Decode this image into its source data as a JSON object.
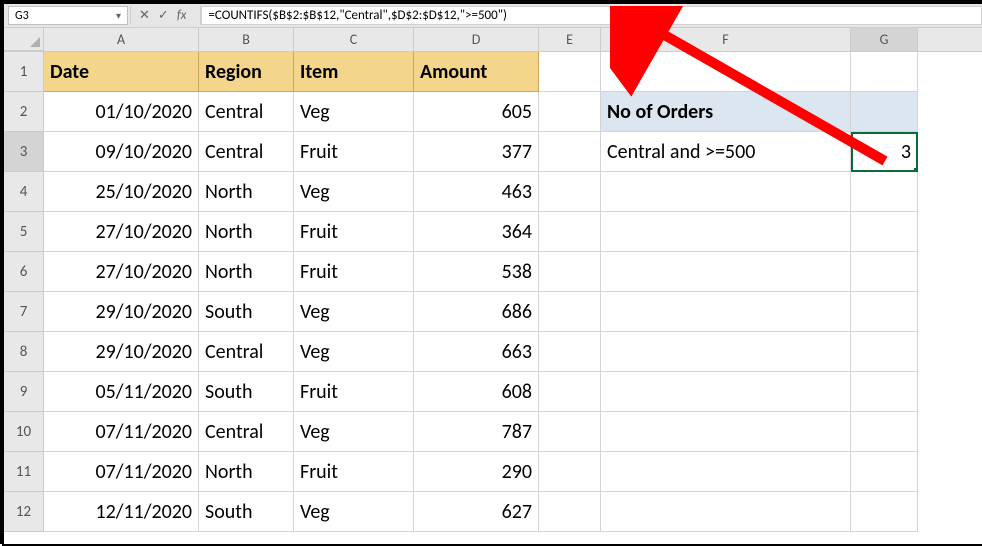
{
  "name_box": "G3",
  "formula": "=COUNTIFS($B$2:$B$12,\"Central\",$D$2:$D$12,\">=500\")",
  "columns": [
    "A",
    "B",
    "C",
    "D",
    "E",
    "F",
    "G"
  ],
  "rows": [
    "1",
    "2",
    "3",
    "4",
    "5",
    "6",
    "7",
    "8",
    "9",
    "10",
    "11",
    "12"
  ],
  "selected_cell": "G3",
  "table": {
    "headers": {
      "A": "Date",
      "B": "Region",
      "C": "Item",
      "D": "Amount"
    },
    "rows": [
      {
        "date": "01/10/2020",
        "region": "Central",
        "item": "Veg",
        "amount": "605"
      },
      {
        "date": "09/10/2020",
        "region": "Central",
        "item": "Fruit",
        "amount": "377"
      },
      {
        "date": "25/10/2020",
        "region": "North",
        "item": "Veg",
        "amount": "463"
      },
      {
        "date": "27/10/2020",
        "region": "North",
        "item": "Fruit",
        "amount": "364"
      },
      {
        "date": "27/10/2020",
        "region": "North",
        "item": "Fruit",
        "amount": "538"
      },
      {
        "date": "29/10/2020",
        "region": "South",
        "item": "Veg",
        "amount": "686"
      },
      {
        "date": "29/10/2020",
        "region": "Central",
        "item": "Veg",
        "amount": "663"
      },
      {
        "date": "05/11/2020",
        "region": "South",
        "item": "Fruit",
        "amount": "608"
      },
      {
        "date": "07/11/2020",
        "region": "Central",
        "item": "Veg",
        "amount": "787"
      },
      {
        "date": "07/11/2020",
        "region": "North",
        "item": "Fruit",
        "amount": "290"
      },
      {
        "date": "12/11/2020",
        "region": "South",
        "item": "Veg",
        "amount": "627"
      }
    ]
  },
  "side": {
    "title": "No of Orders",
    "label": "Central and >=500",
    "result": "3"
  },
  "icons": {
    "cancel": "✕",
    "enter": "✓",
    "fx": "fx"
  }
}
